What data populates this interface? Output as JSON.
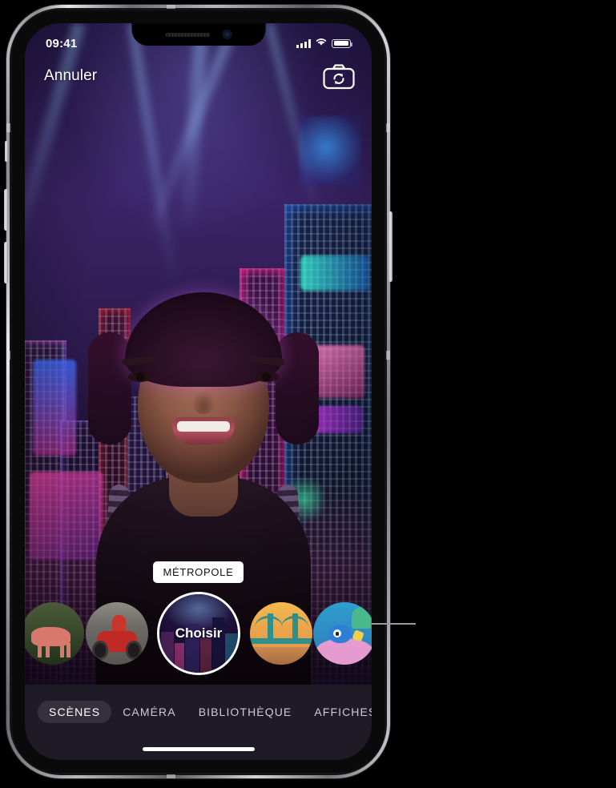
{
  "device": {
    "name": "iphone-x",
    "status_bar": {
      "time": "09:41",
      "cellular_icon": "signal-bars-icon",
      "wifi_icon": "wifi-icon",
      "battery_icon": "battery-full-icon"
    },
    "notch": {
      "speaker_icon": "speaker-grille-icon",
      "camera_icon": "front-camera-icon"
    },
    "home_indicator": "home-indicator"
  },
  "top_controls": {
    "cancel_label": "Annuler",
    "flip_camera_icon": "flip-camera-icon"
  },
  "scene_view": {
    "selected_scene_label": "MÉTROPOLE",
    "description": "neon cyberpunk city backdrop with person in foreground"
  },
  "carousel": {
    "choose_label": "Choisir",
    "items": [
      {
        "id": "forest",
        "name": "forest-deer-scene",
        "art": "art-forest",
        "selected": false
      },
      {
        "id": "street",
        "name": "street-bike-scene",
        "art": "art-street",
        "selected": false
      },
      {
        "id": "metro",
        "name": "metropolis-scene",
        "art": "art-metro",
        "selected": true
      },
      {
        "id": "bridge",
        "name": "bridge-sunset-scene",
        "art": "art-bridge",
        "selected": false
      },
      {
        "id": "reef",
        "name": "coral-reef-scene",
        "art": "art-reef",
        "selected": false
      }
    ]
  },
  "tab_bar": {
    "tabs": [
      {
        "label": "SCÈNES",
        "active": true
      },
      {
        "label": "CAMÉRA",
        "active": false
      },
      {
        "label": "BIBLIOTHÈQUE",
        "active": false
      },
      {
        "label": "AFFICHES",
        "active": false
      }
    ]
  },
  "annotation": {
    "callout_line": "callout-leader-line"
  },
  "colors": {
    "page_background": "#000000",
    "tab_bar_background": "#1e1a26",
    "active_tab_pill": "#34303e",
    "accent_white": "#ffffff",
    "scene_label_background": "#ffffff",
    "scene_label_text": "#121214",
    "callout_line": "#9a9a9a"
  }
}
